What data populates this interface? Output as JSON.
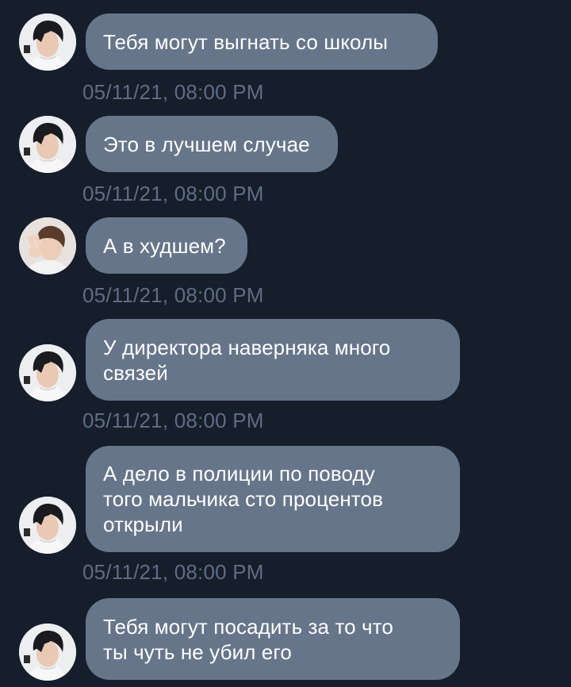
{
  "conversation": {
    "messages": [
      {
        "text": "Тебя могут выгнать со школы",
        "timestamp": "05/11/21, 08:00 PM",
        "avatar": "avatar-boy-black-hair"
      },
      {
        "text": "Это в лучшем случае",
        "timestamp": "05/11/21, 08:00 PM",
        "avatar": "avatar-boy-black-hair"
      },
      {
        "text": "А в худшем?",
        "timestamp": "05/11/21, 08:00 PM",
        "avatar": "avatar-boy-peace-sign"
      },
      {
        "text": "У директора наверняка много\nсвязей",
        "timestamp": "05/11/21, 08:00 PM",
        "avatar": "avatar-boy-black-hair"
      },
      {
        "text": "А дело в полиции по поводу\nтого мальчика сто процентов\nоткрыли",
        "timestamp": "05/11/21, 08:00 PM",
        "avatar": "avatar-boy-black-hair"
      },
      {
        "text": "Тебя могут посадить за то что\nты чуть не убил его",
        "timestamp": "",
        "avatar": "avatar-boy-black-hair"
      }
    ]
  },
  "colors": {
    "background": "#161d2b",
    "bubble": "#66758a",
    "bubble_text": "#ffffff",
    "timestamp": "#5f6d82"
  }
}
